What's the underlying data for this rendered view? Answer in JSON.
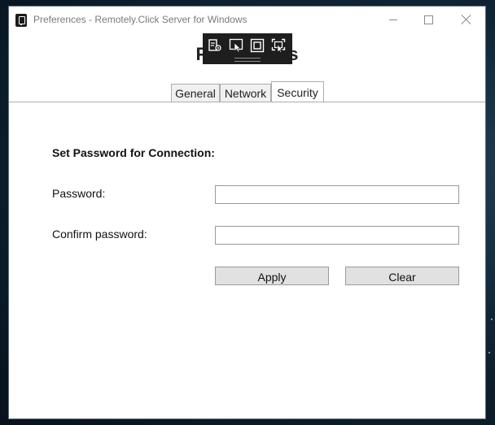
{
  "window": {
    "title": "Preferences - Remotely.Click Server for Windows",
    "heading": "Preferences"
  },
  "overlay_toolbar": {
    "tools": [
      "device-settings-icon",
      "select-pointer-icon",
      "capture-window-icon",
      "capture-region-icon"
    ]
  },
  "tabs": [
    {
      "label": "General",
      "active": false
    },
    {
      "label": "Network",
      "active": false
    },
    {
      "label": "Security",
      "active": true
    }
  ],
  "security": {
    "section_title": "Set Password for Connection:",
    "password_label": "Password:",
    "password_value": "",
    "confirm_label": "Confirm password:",
    "confirm_value": "",
    "apply_label": "Apply",
    "clear_label": "Clear"
  }
}
